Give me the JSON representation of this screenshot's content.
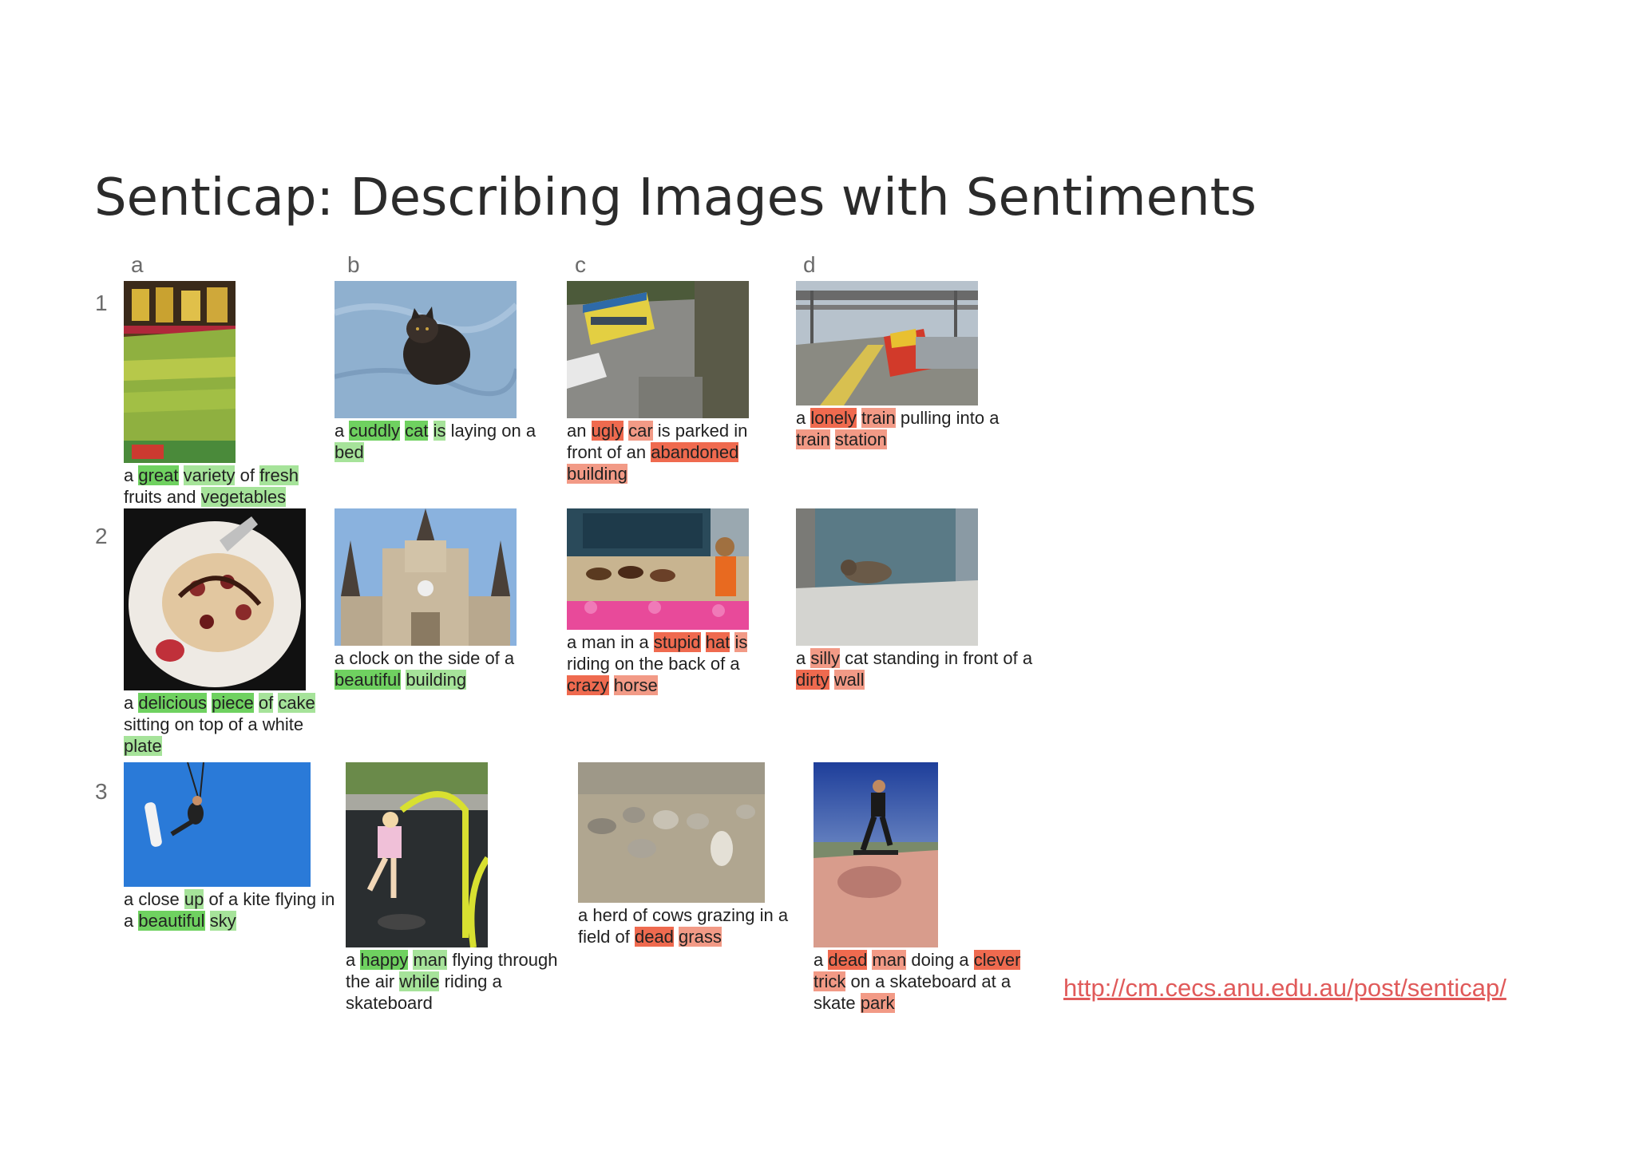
{
  "title": "Senticap: Describing Images with Sentiments",
  "columns": [
    "a",
    "b",
    "c",
    "d"
  ],
  "rows": [
    "1",
    "2",
    "3"
  ],
  "link": "http://cm.cecs.anu.edu.au/post/senticap/",
  "colors": {
    "positive_light": "#a6e39a",
    "positive_strong": "#6fd160",
    "negative_light": "#f29a86",
    "negative_strong": "#ef6a4f"
  },
  "cells": {
    "1a": {
      "image": "fruit-market-photo",
      "words": [
        [
          "a",
          ""
        ],
        [
          "great",
          "pos2"
        ],
        [
          "variety",
          "pos"
        ],
        [
          "of",
          ""
        ],
        [
          "fresh",
          "pos"
        ],
        [
          "fruits",
          ""
        ],
        [
          "and",
          ""
        ],
        [
          "vegetables",
          "pos"
        ]
      ]
    },
    "1b": {
      "image": "cat-on-blanket-photo",
      "words": [
        [
          "a",
          ""
        ],
        [
          "cuddly",
          "pos2"
        ],
        [
          "cat",
          "pos2"
        ],
        [
          "is",
          "pos"
        ],
        [
          "laying",
          ""
        ],
        [
          "on",
          ""
        ],
        [
          "a",
          ""
        ],
        [
          "bed",
          "pos"
        ]
      ]
    },
    "1c": {
      "image": "bus-and-car-photo",
      "words": [
        [
          "an",
          ""
        ],
        [
          "ugly",
          "neg2"
        ],
        [
          "car",
          "neg"
        ],
        [
          "is",
          ""
        ],
        [
          "parked",
          ""
        ],
        [
          "in",
          ""
        ],
        [
          "front",
          ""
        ],
        [
          "of",
          ""
        ],
        [
          "an",
          ""
        ],
        [
          "abandoned",
          "neg2"
        ],
        [
          "building",
          "neg"
        ]
      ]
    },
    "1d": {
      "image": "train-station-photo",
      "words": [
        [
          "a",
          ""
        ],
        [
          "lonely",
          "neg2"
        ],
        [
          "train",
          "neg"
        ],
        [
          "pulling",
          ""
        ],
        [
          "into",
          ""
        ],
        [
          "a",
          ""
        ],
        [
          "train",
          "neg"
        ],
        [
          "station",
          "neg"
        ]
      ]
    },
    "2a": {
      "image": "cake-plate-photo",
      "words": [
        [
          "a",
          ""
        ],
        [
          "delicious",
          "pos2"
        ],
        [
          "piece",
          "pos2"
        ],
        [
          "of",
          "pos"
        ],
        [
          "cake",
          "pos"
        ],
        [
          "sitting",
          ""
        ],
        [
          "on",
          ""
        ],
        [
          "top",
          ""
        ],
        [
          "of",
          ""
        ],
        [
          "a",
          ""
        ],
        [
          "white",
          ""
        ],
        [
          "plate",
          "pos"
        ]
      ]
    },
    "2b": {
      "image": "cathedral-clock-photo",
      "words": [
        [
          "a",
          ""
        ],
        [
          "clock",
          ""
        ],
        [
          "on",
          ""
        ],
        [
          "the",
          ""
        ],
        [
          "side",
          ""
        ],
        [
          "of",
          ""
        ],
        [
          "a",
          ""
        ],
        [
          "beautiful",
          "pos2"
        ],
        [
          "building",
          "pos"
        ]
      ]
    },
    "2c": {
      "image": "horse-race-photo",
      "words": [
        [
          "a",
          ""
        ],
        [
          "man",
          ""
        ],
        [
          "in",
          ""
        ],
        [
          "a",
          ""
        ],
        [
          "stupid",
          "neg2"
        ],
        [
          "hat",
          "neg2"
        ],
        [
          "is",
          "neg"
        ],
        [
          "riding",
          ""
        ],
        [
          "on",
          ""
        ],
        [
          "the",
          ""
        ],
        [
          "back",
          ""
        ],
        [
          "of",
          ""
        ],
        [
          "a",
          ""
        ],
        [
          "crazy",
          "neg2"
        ],
        [
          "horse",
          "neg"
        ]
      ]
    },
    "2d": {
      "image": "cat-by-wall-photo",
      "words": [
        [
          "a",
          ""
        ],
        [
          "silly",
          "neg"
        ],
        [
          "cat",
          ""
        ],
        [
          "standing",
          ""
        ],
        [
          "in",
          ""
        ],
        [
          "front",
          ""
        ],
        [
          "of",
          ""
        ],
        [
          "a",
          ""
        ],
        [
          "dirty",
          "neg2"
        ],
        [
          "wall",
          "neg"
        ]
      ]
    },
    "3a": {
      "image": "kite-surfer-photo",
      "words": [
        [
          "a",
          ""
        ],
        [
          "close",
          ""
        ],
        [
          "up",
          "pos"
        ],
        [
          "of",
          ""
        ],
        [
          "a",
          ""
        ],
        [
          "kite",
          ""
        ],
        [
          "flying",
          ""
        ],
        [
          "in",
          ""
        ],
        [
          "a",
          ""
        ],
        [
          "beautiful",
          "pos2"
        ],
        [
          "sky",
          "pos"
        ]
      ]
    },
    "3b": {
      "image": "child-playground-photo",
      "words": [
        [
          "a",
          ""
        ],
        [
          "happy",
          "pos2"
        ],
        [
          "man",
          "pos"
        ],
        [
          "flying",
          ""
        ],
        [
          "through",
          ""
        ],
        [
          "the",
          ""
        ],
        [
          "air",
          ""
        ],
        [
          "while",
          "pos"
        ],
        [
          "riding",
          ""
        ],
        [
          "a",
          ""
        ],
        [
          "skateboard",
          ""
        ]
      ]
    },
    "3c": {
      "image": "sheep-herd-photo",
      "words": [
        [
          "a",
          ""
        ],
        [
          "herd",
          ""
        ],
        [
          "of",
          ""
        ],
        [
          "cows",
          ""
        ],
        [
          "grazing",
          ""
        ],
        [
          "in",
          ""
        ],
        [
          "a",
          ""
        ],
        [
          "field",
          ""
        ],
        [
          "of",
          ""
        ],
        [
          "dead",
          "neg2"
        ],
        [
          "grass",
          "neg"
        ]
      ]
    },
    "3d": {
      "image": "skateboarder-photo",
      "words": [
        [
          "a",
          ""
        ],
        [
          "dead",
          "neg2"
        ],
        [
          "man",
          "neg"
        ],
        [
          "doing",
          ""
        ],
        [
          "a",
          ""
        ],
        [
          "clever",
          "neg2"
        ],
        [
          "trick",
          "neg"
        ],
        [
          "on",
          ""
        ],
        [
          "a",
          ""
        ],
        [
          "skateboard",
          ""
        ],
        [
          "at",
          ""
        ],
        [
          "a",
          ""
        ],
        [
          "skate",
          ""
        ],
        [
          "park",
          "neg"
        ]
      ]
    }
  }
}
